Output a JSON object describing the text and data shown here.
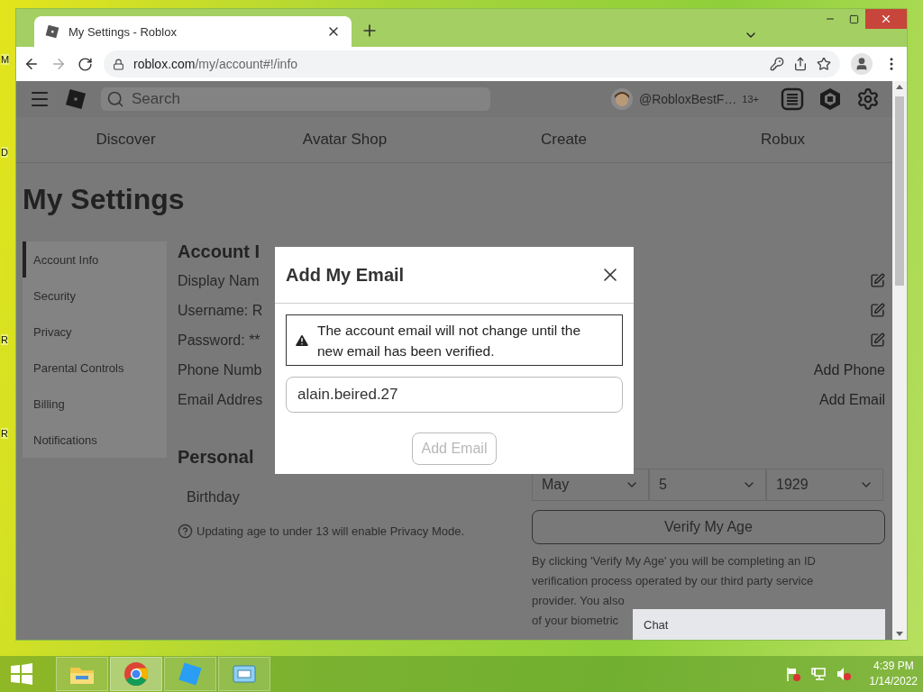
{
  "desktop": {
    "icon_labels": [
      "M",
      "D",
      "R",
      "R"
    ]
  },
  "browser": {
    "tabs": [
      {
        "title": "My Settings - Roblox",
        "selected": true
      }
    ],
    "address": {
      "host": "roblox.com",
      "path": "/my/account#!/info"
    }
  },
  "page": {
    "header": {
      "search": {
        "placeholder": "Search"
      },
      "username": "@RobloxBestF…",
      "age_badge": "13+"
    },
    "nav": [
      "Discover",
      "Avatar Shop",
      "Create",
      "Robux"
    ],
    "title": "My Settings",
    "sidebar": [
      {
        "label": "Account Info",
        "selected": true
      },
      {
        "label": "Security",
        "selected": false
      },
      {
        "label": "Privacy",
        "selected": false
      },
      {
        "label": "Parental Controls",
        "selected": false
      },
      {
        "label": "Billing",
        "selected": false
      },
      {
        "label": "Notifications",
        "selected": false
      }
    ],
    "account_info": {
      "heading": "Account I",
      "rows": [
        {
          "label": "Display Nam",
          "kind": "edit"
        },
        {
          "label": "Username: R",
          "kind": "edit"
        },
        {
          "label": "Password: **",
          "kind": "edit"
        },
        {
          "label": "Phone Numb",
          "kind": "link",
          "action": "Add Phone"
        },
        {
          "label": "Email Addres",
          "kind": "link",
          "action": "Add Email"
        }
      ]
    },
    "personal": {
      "heading": "Personal",
      "birthday_label": "Birthday",
      "month": "May",
      "day": "5",
      "year": "1929",
      "note": "Updating age to under 13 will enable Privacy Mode.",
      "verify_button": "Verify My Age",
      "disclaimer": [
        "By clicking 'Verify My Age' you will be completing an ID",
        "verification process operated by our third party service",
        "provider. You also",
        "of your biometric"
      ]
    },
    "chat": {
      "label": "Chat"
    }
  },
  "modal": {
    "title": "Add My Email",
    "warning": "The account email will not change until the new email has been verified.",
    "email": "alain.beired.27",
    "button": {
      "label": "Add Email",
      "disabled": true
    }
  },
  "taskbar": {
    "apps": [
      {
        "kind": "explorer",
        "selected": false
      },
      {
        "kind": "chrome",
        "selected": true
      },
      {
        "kind": "roblox",
        "selected": false
      },
      {
        "kind": "window",
        "selected": false
      }
    ],
    "time": "4:39 PM",
    "date": "1/14/2022"
  }
}
